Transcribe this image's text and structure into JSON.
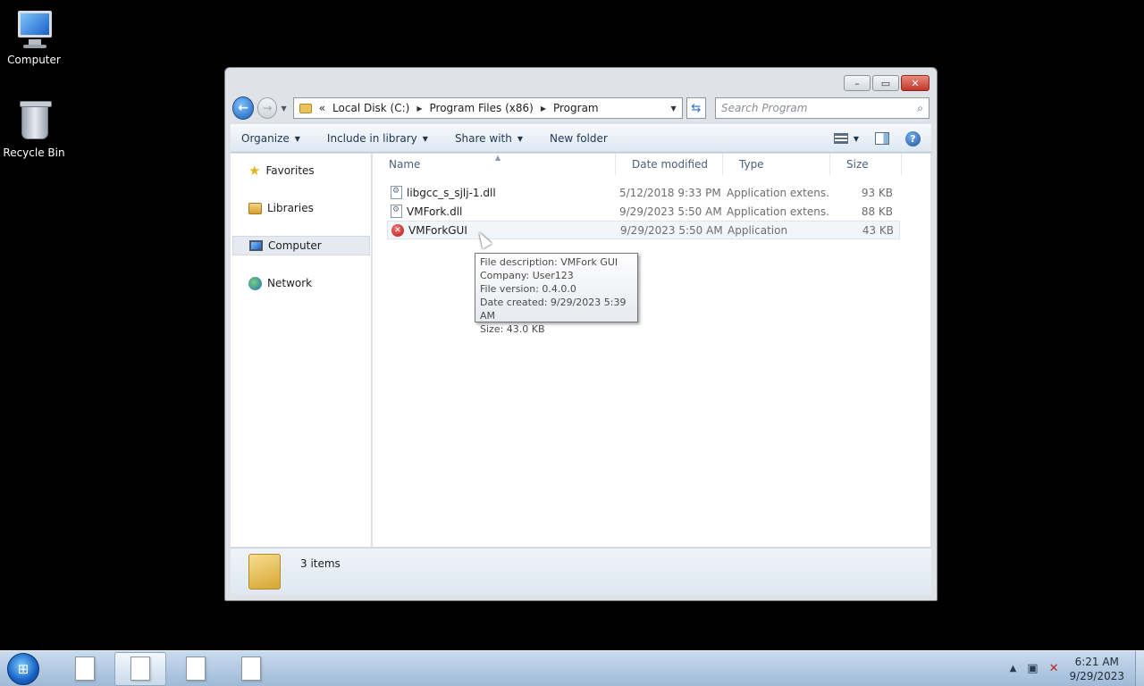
{
  "desktop": {
    "icons": [
      {
        "label": "Computer"
      },
      {
        "label": "Recycle Bin"
      }
    ]
  },
  "window": {
    "caption_buttons": {
      "minimize": "–",
      "maximize": "▭",
      "close": "✕"
    },
    "breadcrumb": {
      "overflow": "«",
      "segments": [
        "Local Disk (C:)",
        "Program Files (x86)",
        "Program"
      ]
    },
    "search": {
      "placeholder": "Search Program"
    },
    "toolbar": {
      "organize": "Organize",
      "include_in_library": "Include in library",
      "share_with": "Share with",
      "new_folder": "New folder"
    },
    "nav_pane": {
      "items": [
        {
          "label": "Favorites"
        },
        {
          "label": "Libraries"
        },
        {
          "label": "Computer"
        },
        {
          "label": "Network"
        }
      ]
    },
    "columns": [
      "Name",
      "Date modified",
      "Type",
      "Size"
    ],
    "files": [
      {
        "name": "libgcc_s_sjlj-1.dll",
        "date": "5/12/2018 9:33 PM",
        "type": "Application extens...",
        "size": "93 KB",
        "icon": "dll-icon"
      },
      {
        "name": "VMFork.dll",
        "date": "9/29/2023 5:50 AM",
        "type": "Application extens...",
        "size": "88 KB",
        "icon": "dll-icon"
      },
      {
        "name": "VMForkGUI",
        "date": "9/29/2023 5:50 AM",
        "type": "Application",
        "size": "43 KB",
        "icon": "error-exe-icon"
      }
    ],
    "tooltip": {
      "lines": [
        "File description: VMFork GUI",
        "Company: User123",
        "File version: 0.4.0.0",
        "Date created: 9/29/2023 5:39 AM",
        "Size: 43.0 KB"
      ]
    },
    "status": {
      "items_count": "3 items"
    }
  },
  "taskbar": {
    "clock": {
      "time": "6:21 AM",
      "date": "9/29/2023"
    }
  },
  "colors": {
    "desktop_bg": "#000000",
    "taskbar": "#b3c9e2",
    "accent": "#1f5fb5"
  }
}
